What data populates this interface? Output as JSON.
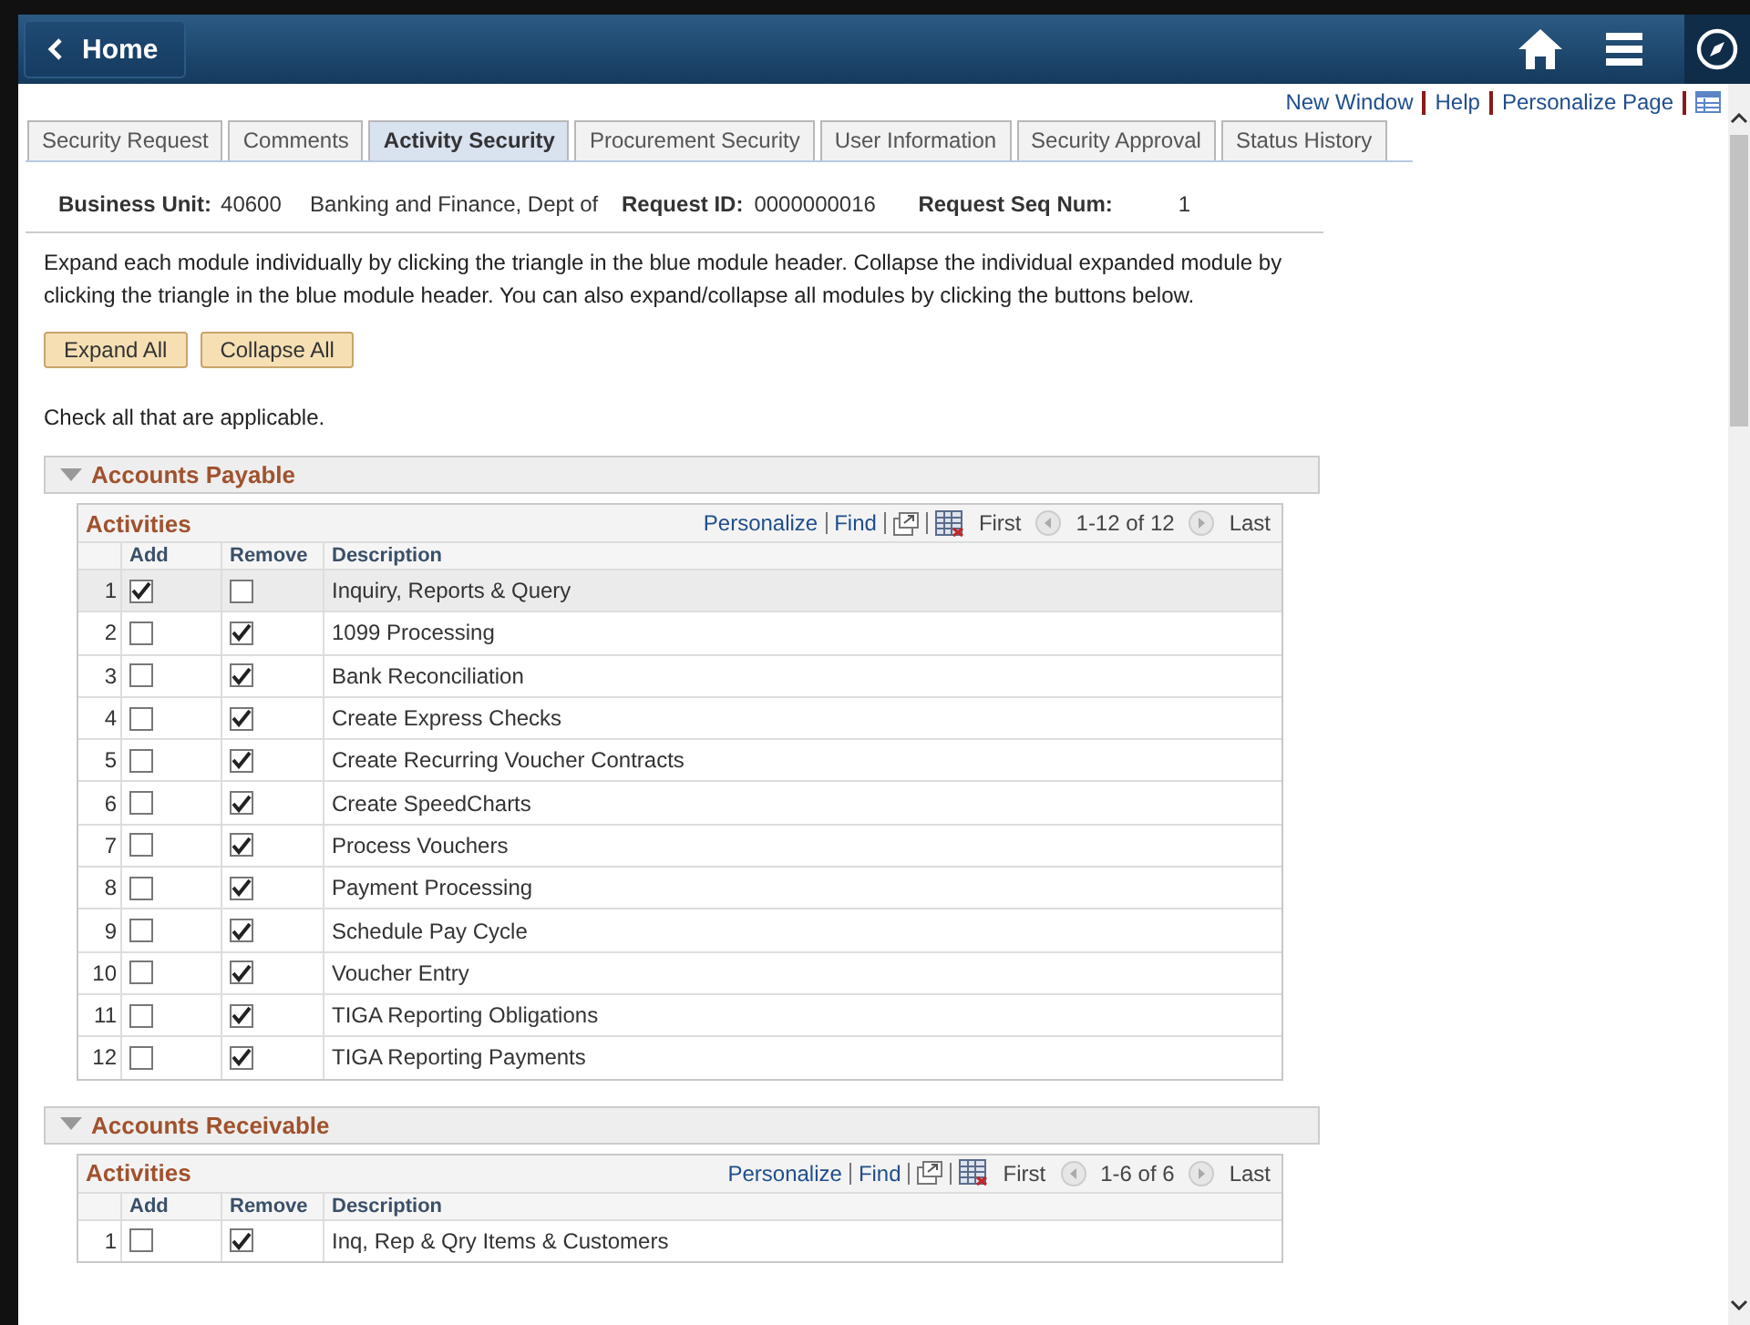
{
  "header": {
    "back_label": "Home"
  },
  "page_links": [
    "New Window",
    "Help",
    "Personalize Page"
  ],
  "tabs": [
    {
      "label": "Security Request",
      "selected": false
    },
    {
      "label": "Comments",
      "selected": false
    },
    {
      "label": "Activity Security",
      "selected": true
    },
    {
      "label": "Procurement Security",
      "selected": false
    },
    {
      "label": "User Information",
      "selected": false
    },
    {
      "label": "Security Approval",
      "selected": false
    },
    {
      "label": "Status History",
      "selected": false
    }
  ],
  "info": {
    "business_unit_label": "Business Unit:",
    "business_unit": "40600",
    "business_unit_name": "Banking and Finance, Dept of",
    "request_id_label": "Request ID:",
    "request_id": "0000000016",
    "seq_label": "Request Seq Num:",
    "seq": "1"
  },
  "instructions": "Expand each module individually by clicking the triangle in the blue module header. Collapse the individual expanded module by clicking the triangle in the blue module header. You can also expand/collapse all modules by clicking the buttons below.",
  "buttons": [
    "Expand All",
    "Collapse All"
  ],
  "check_note": "Check all that are applicable.",
  "modules": [
    {
      "title": "Accounts Payable",
      "expanded": true,
      "grid": {
        "title": "Activities",
        "links": [
          "Personalize",
          "Find"
        ],
        "first": "First",
        "range": "1-12 of 12",
        "last": "Last",
        "columns": [
          "Add",
          "Remove",
          "Description"
        ],
        "rows": [
          {
            "num": "1",
            "add": true,
            "remove": false,
            "description": "Inquiry, Reports & Query",
            "selected": true
          },
          {
            "num": "2",
            "add": false,
            "remove": true,
            "description": "1099 Processing",
            "selected": false
          },
          {
            "num": "3",
            "add": false,
            "remove": true,
            "description": "Bank Reconciliation",
            "selected": false
          },
          {
            "num": "4",
            "add": false,
            "remove": true,
            "description": "Create Express Checks",
            "selected": false
          },
          {
            "num": "5",
            "add": false,
            "remove": true,
            "description": "Create Recurring Voucher Contracts",
            "selected": false
          },
          {
            "num": "6",
            "add": false,
            "remove": true,
            "description": "Create SpeedCharts",
            "selected": false
          },
          {
            "num": "7",
            "add": false,
            "remove": true,
            "description": "Process Vouchers",
            "selected": false
          },
          {
            "num": "8",
            "add": false,
            "remove": true,
            "description": "Payment Processing",
            "selected": false
          },
          {
            "num": "9",
            "add": false,
            "remove": true,
            "description": "Schedule Pay Cycle",
            "selected": false
          },
          {
            "num": "10",
            "add": false,
            "remove": true,
            "description": "Voucher Entry",
            "selected": false
          },
          {
            "num": "11",
            "add": false,
            "remove": true,
            "description": "TIGA Reporting Obligations",
            "selected": false
          },
          {
            "num": "12",
            "add": false,
            "remove": true,
            "description": "TIGA Reporting Payments",
            "selected": false
          }
        ]
      }
    },
    {
      "title": "Accounts Receivable",
      "expanded": true,
      "grid": {
        "title": "Activities",
        "links": [
          "Personalize",
          "Find"
        ],
        "first": "First",
        "range": "1-6 of 6",
        "last": "Last",
        "columns": [
          "Add",
          "Remove",
          "Description"
        ],
        "rows": [
          {
            "num": "1",
            "add": false,
            "remove": true,
            "description": "Inq, Rep & Qry Items & Customers",
            "selected": false
          }
        ]
      }
    }
  ]
}
